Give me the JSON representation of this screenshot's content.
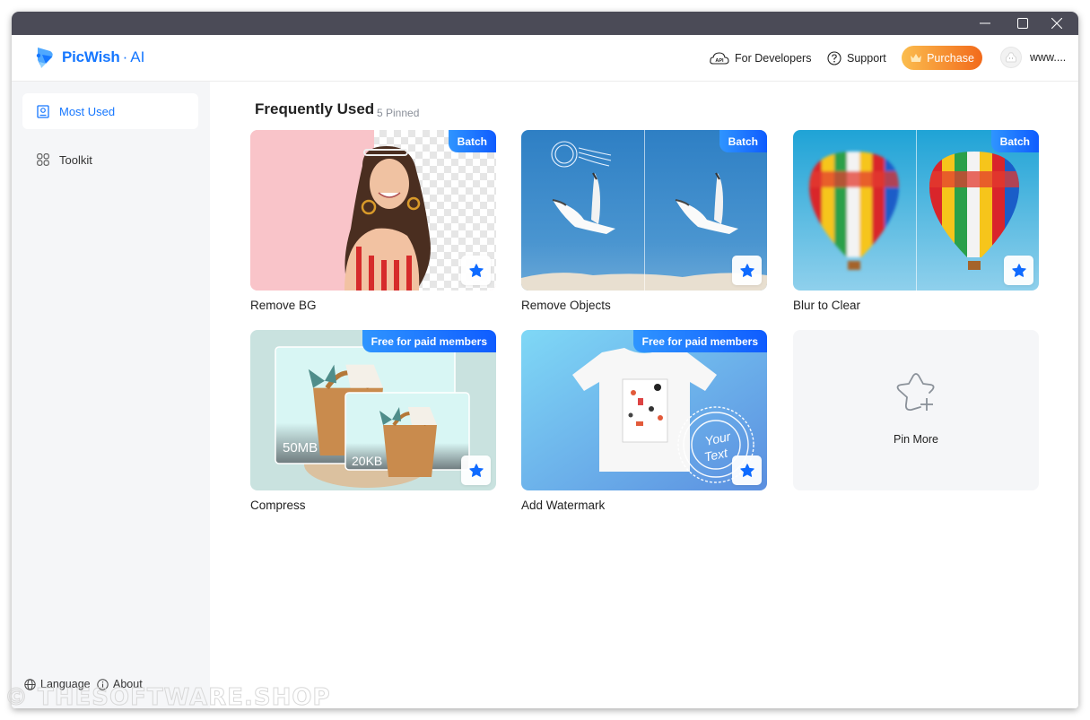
{
  "window": {
    "controls": {
      "minimize": "minimize",
      "maximize": "maximize",
      "close": "close"
    }
  },
  "header": {
    "brand": "PicWish",
    "brand_suffix": "AI",
    "brand_separator": "·",
    "links": [
      {
        "label": "For Developers",
        "icon": "api-cloud-icon"
      },
      {
        "label": "Support",
        "icon": "question-circle-icon"
      }
    ],
    "purchase_label": "Purchase",
    "user_name": "www...."
  },
  "sidebar": {
    "items": [
      {
        "label": "Most Used",
        "icon": "badge-icon",
        "active": true
      },
      {
        "label": "Toolkit",
        "icon": "grid-icon",
        "active": false
      }
    ],
    "footer": {
      "language_label": "Language",
      "about_label": "About"
    }
  },
  "main": {
    "section_title": "Frequently Used",
    "pinned_count": "5 Pinned",
    "cards": [
      {
        "label": "Remove BG",
        "badge": "Batch",
        "pinned": true
      },
      {
        "label": "Remove Objects",
        "badge": "Batch",
        "pinned": true
      },
      {
        "label": "Blur to Clear",
        "badge": "Batch",
        "pinned": true
      },
      {
        "label": "Compress",
        "badge": "Free for paid members",
        "pinned": true,
        "size_before": "50MB",
        "size_after": "20KB"
      },
      {
        "label": "Add Watermark",
        "badge": "Free for paid members",
        "pinned": true,
        "stamp_text": "Your Text"
      }
    ],
    "pin_more_label": "Pin More"
  },
  "overlay": {
    "watermark": "© THESOFTWARE.SHOP"
  },
  "colors": {
    "accent": "#1677ff",
    "purchase_start": "#fbbd4e",
    "purchase_end": "#f26a1b",
    "titlebar": "#4b4b57",
    "sidebar_bg": "#f5f6f8"
  }
}
